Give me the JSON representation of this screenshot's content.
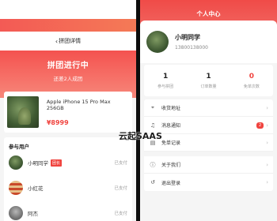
{
  "left": {
    "nav_title": "拼团详情",
    "back_icon": "back-arrow-icon",
    "hero_title": "拼团进行中",
    "hero_subtitle": "还差2人成团",
    "product": {
      "name": "Apple iPhone 15 Pro Max 256GB",
      "price": "¥8999"
    },
    "members_title": "参与用户",
    "members": [
      {
        "name": "小明同学",
        "tag": "团长",
        "status": "已支付"
      },
      {
        "name": "小红花",
        "tag": "",
        "status": "已支付"
      },
      {
        "name": "阿杰",
        "tag": "",
        "status": "已支付"
      }
    ]
  },
  "right": {
    "title": "个人中心",
    "user": {
      "name": "小明同学",
      "phone": "13800138000"
    },
    "stats": [
      {
        "value": "1",
        "label": "参与拼团"
      },
      {
        "value": "1",
        "label": "订单数量"
      },
      {
        "value": "0",
        "label": "免单次数"
      }
    ],
    "menu": [
      {
        "icon": "location-icon",
        "glyph": "⌖",
        "label": "收货地址",
        "badge": ""
      },
      {
        "icon": "bell-icon",
        "glyph": "🔔",
        "label": "消息通知",
        "badge": "2"
      },
      {
        "icon": "document-icon",
        "glyph": "▤",
        "label": "免单记录",
        "badge": ""
      },
      {
        "icon": "info-icon",
        "glyph": "ⓘ",
        "label": "关于我们",
        "badge": ""
      },
      {
        "icon": "logout-icon",
        "glyph": "↺",
        "label": "退出登录",
        "badge": ""
      }
    ]
  },
  "watermark": "云起SAAS",
  "colors": {
    "accent": "#f0443f",
    "header_top": "#f04b48",
    "header_bottom": "#f3837a"
  }
}
